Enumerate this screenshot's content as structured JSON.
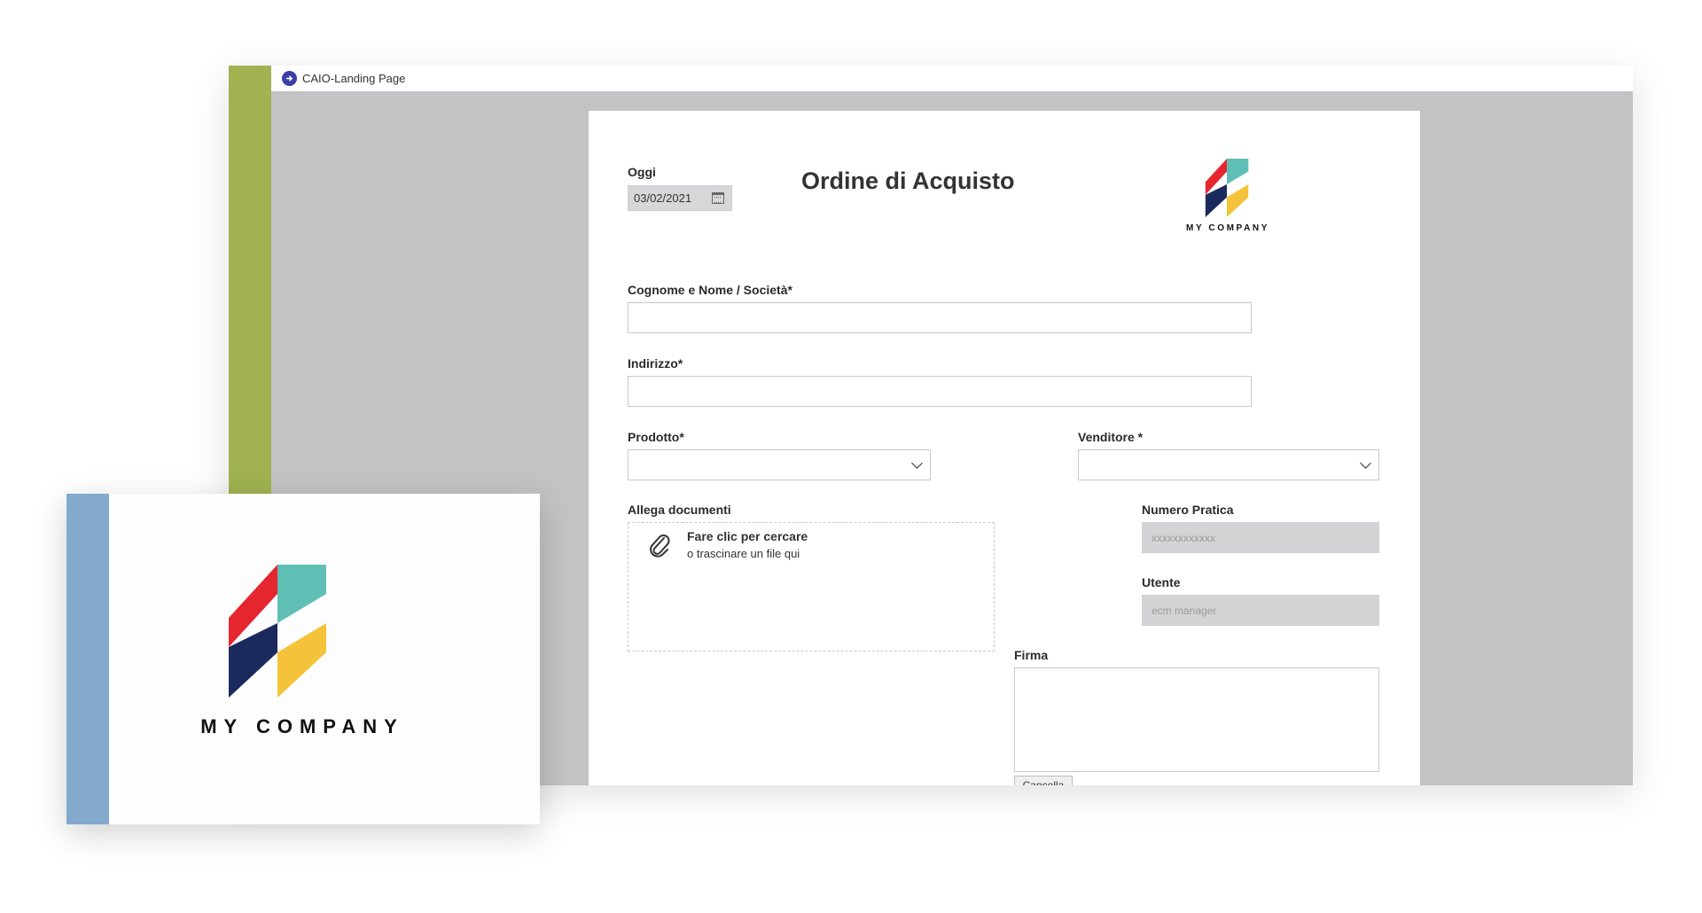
{
  "window": {
    "title": "CAIO-Landing Page",
    "stripe_color": "#a0b350",
    "app_icon": "arrow-circle-icon",
    "app_icon_color": "#3b3fa8"
  },
  "form": {
    "title": "Ordine di Acquisto",
    "date_label": "Oggi",
    "date_value": "03/02/2021",
    "name_label": "Cognome e Nome / Società*",
    "address_label": "Indirizzo*",
    "product_label": "Prodotto*",
    "seller_label": "Venditore *",
    "attach_label": "Allega documenti",
    "attach_title": "Fare clic per cercare",
    "attach_subtitle": "o trascinare un file qui",
    "practice_label": "Numero Pratica",
    "practice_placeholder": "xxxxxxxxxxxx",
    "user_label": "Utente",
    "user_value": "ecm manager",
    "signature_label": "Firma",
    "cancel_label": "Cancella"
  },
  "logo": {
    "text": "MY COMPANY",
    "colors": {
      "red": "#e5262f",
      "teal": "#5fbfb5",
      "navy": "#1b2a5c",
      "yellow": "#f4c33a"
    }
  },
  "overlay": {
    "stripe_color": "#83a9cc",
    "logo_text": "MY COMPANY"
  }
}
